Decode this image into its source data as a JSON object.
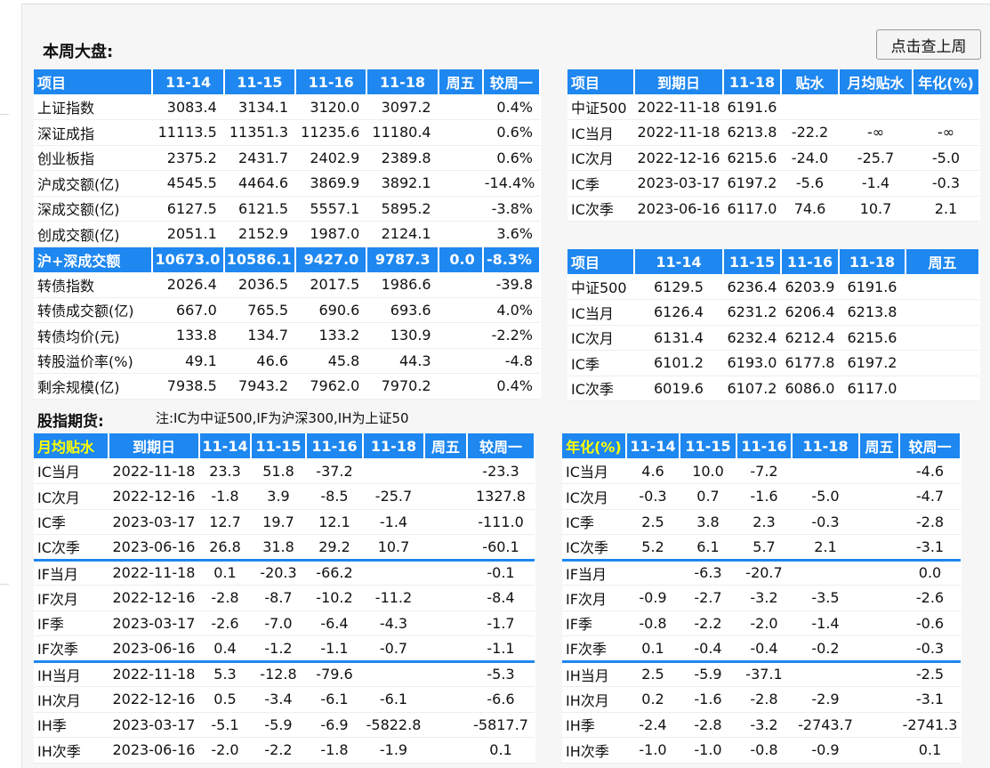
{
  "title": "本周大盘:",
  "prev_week_button": "点击查上周",
  "futures_title": "股指期货:",
  "futures_note": "注:IC为中证500,IF为沪深300,IH为上证50",
  "market": {
    "headers": [
      "项目",
      "11-14",
      "11-15",
      "11-16",
      "11-18",
      "周五",
      "较周一"
    ],
    "rows": [
      [
        "上证指数",
        "3083.4",
        "3134.1",
        "3120.0",
        "3097.2",
        "",
        "0.4%"
      ],
      [
        "深证成指",
        "11113.5",
        "11351.3",
        "11235.6",
        "11180.4",
        "",
        "0.6%"
      ],
      [
        "创业板指",
        "2375.2",
        "2431.7",
        "2402.9",
        "2389.8",
        "",
        "0.6%"
      ],
      [
        "沪成交额(亿)",
        "4545.5",
        "4464.6",
        "3869.9",
        "3892.1",
        "",
        "-14.4%"
      ],
      [
        "深成交额(亿)",
        "6127.5",
        "6121.5",
        "5557.1",
        "5895.2",
        "",
        "-3.8%"
      ],
      [
        "创成交额(亿)",
        "2051.1",
        "2152.9",
        "1987.0",
        "2124.1",
        "",
        "3.6%"
      ],
      [
        "沪+深成交额",
        "10673.0",
        "10586.1",
        "9427.0",
        "9787.3",
        "0.0",
        "-8.3%"
      ],
      [
        "转债指数",
        "2026.4",
        "2036.5",
        "2017.5",
        "1986.6",
        "",
        "-39.8"
      ],
      [
        "转债成交额(亿)",
        "667.0",
        "765.5",
        "690.6",
        "693.6",
        "",
        "4.0%"
      ],
      [
        "转债均价(元)",
        "133.8",
        "134.7",
        "133.2",
        "130.9",
        "",
        "-2.2%"
      ],
      [
        "转股溢价率(%)",
        "49.1",
        "46.6",
        "45.8",
        "44.3",
        "",
        "-4.8"
      ],
      [
        "剩余规模(亿)",
        "7938.5",
        "7943.2",
        "7962.0",
        "7970.2",
        "",
        "0.4%"
      ]
    ]
  },
  "basis": {
    "headers": [
      "项目",
      "到期日",
      "11-18",
      "贴水",
      "月均贴水",
      "年化(%)"
    ],
    "rows": [
      [
        "中证500",
        "2022-11-18",
        "6191.6",
        "",
        "",
        ""
      ],
      [
        "IC当月",
        "2022-11-18",
        "6213.8",
        "-22.2",
        "-∞",
        "-∞"
      ],
      [
        "IC次月",
        "2022-12-16",
        "6215.6",
        "-24.0",
        "-25.7",
        "-5.0"
      ],
      [
        "IC季",
        "2023-03-17",
        "6197.2",
        "-5.6",
        "-1.4",
        "-0.3"
      ],
      [
        "IC次季",
        "2023-06-16",
        "6117.0",
        "74.6",
        "10.7",
        "2.1"
      ]
    ]
  },
  "prices": {
    "headers": [
      "项目",
      "11-14",
      "11-15",
      "11-16",
      "11-18",
      "周五"
    ],
    "rows": [
      [
        "中证500",
        "6129.5",
        "6236.4",
        "6203.9",
        "6191.6",
        ""
      ],
      [
        "IC当月",
        "6126.4",
        "6231.2",
        "6206.4",
        "6213.8",
        ""
      ],
      [
        "IC次月",
        "6131.4",
        "6232.4",
        "6212.4",
        "6215.6",
        ""
      ],
      [
        "IC季",
        "6101.2",
        "6193.0",
        "6177.8",
        "6197.2",
        ""
      ],
      [
        "IC次季",
        "6019.6",
        "6107.2",
        "6086.0",
        "6117.0",
        ""
      ]
    ]
  },
  "monthly": {
    "headers": [
      "月均贴水",
      "到期日",
      "11-14",
      "11-15",
      "11-16",
      "11-18",
      "周五",
      "较周一"
    ],
    "rows": [
      [
        "IC当月",
        "2022-11-18",
        "23.3",
        "51.8",
        "-37.2",
        "",
        "",
        "-23.3"
      ],
      [
        "IC次月",
        "2022-12-16",
        "-1.8",
        "3.9",
        "-8.5",
        "-25.7",
        "",
        "1327.8"
      ],
      [
        "IC季",
        "2023-03-17",
        "12.7",
        "19.7",
        "12.1",
        "-1.4",
        "",
        "-111.0"
      ],
      [
        "IC次季",
        "2023-06-16",
        "26.8",
        "31.8",
        "29.2",
        "10.7",
        "",
        "-60.1"
      ],
      [
        "IF当月",
        "2022-11-18",
        "0.1",
        "-20.3",
        "-66.2",
        "",
        "",
        "-0.1"
      ],
      [
        "IF次月",
        "2022-12-16",
        "-2.8",
        "-8.7",
        "-10.2",
        "-11.2",
        "",
        "-8.4"
      ],
      [
        "IF季",
        "2023-03-17",
        "-2.6",
        "-7.0",
        "-6.4",
        "-4.3",
        "",
        "-1.7"
      ],
      [
        "IF次季",
        "2023-06-16",
        "0.4",
        "-1.2",
        "-1.1",
        "-0.7",
        "",
        "-1.1"
      ],
      [
        "IH当月",
        "2022-11-18",
        "5.3",
        "-12.8",
        "-79.6",
        "",
        "",
        "-5.3"
      ],
      [
        "IH次月",
        "2022-12-16",
        "0.5",
        "-3.4",
        "-6.1",
        "-6.1",
        "",
        "-6.6"
      ],
      [
        "IH季",
        "2023-03-17",
        "-5.1",
        "-5.9",
        "-6.9",
        "-5822.8",
        "",
        "-5817.7"
      ],
      [
        "IH次季",
        "2023-06-16",
        "-2.0",
        "-2.2",
        "-1.8",
        "-1.9",
        "",
        "0.1"
      ]
    ]
  },
  "annual": {
    "headers": [
      "年化(%)",
      "11-14",
      "11-15",
      "11-16",
      "11-18",
      "周五",
      "较周一"
    ],
    "rows": [
      [
        "IC当月",
        "4.6",
        "10.0",
        "-7.2",
        "",
        "",
        "-4.6"
      ],
      [
        "IC次月",
        "-0.3",
        "0.7",
        "-1.6",
        "-5.0",
        "",
        "-4.7"
      ],
      [
        "IC季",
        "2.5",
        "3.8",
        "2.3",
        "-0.3",
        "",
        "-2.8"
      ],
      [
        "IC次季",
        "5.2",
        "6.1",
        "5.7",
        "2.1",
        "",
        "-3.1"
      ],
      [
        "IF当月",
        "",
        "-6.3",
        "-20.7",
        "",
        "",
        "0.0"
      ],
      [
        "IF次月",
        "-0.9",
        "-2.7",
        "-3.2",
        "-3.5",
        "",
        "-2.6"
      ],
      [
        "IF季",
        "-0.8",
        "-2.2",
        "-2.0",
        "-1.4",
        "",
        "-0.6"
      ],
      [
        "IF次季",
        "0.1",
        "-0.4",
        "-0.4",
        "-0.2",
        "",
        "-0.3"
      ],
      [
        "IH当月",
        "2.5",
        "-5.9",
        "-37.1",
        "",
        "",
        "-2.5"
      ],
      [
        "IH次月",
        "0.2",
        "-1.6",
        "-2.8",
        "-2.9",
        "",
        "-3.1"
      ],
      [
        "IH季",
        "-2.4",
        "-2.8",
        "-3.2",
        "-2743.7",
        "",
        "-2741.3"
      ],
      [
        "IH次季",
        "-1.0",
        "-1.0",
        "-0.8",
        "-0.9",
        "",
        "0.1"
      ]
    ]
  },
  "colors": {
    "header_bg": "#1e87f0",
    "header_text": "#ffffff",
    "highlight_text": "#ffff00",
    "separator": "#1e87f0"
  }
}
